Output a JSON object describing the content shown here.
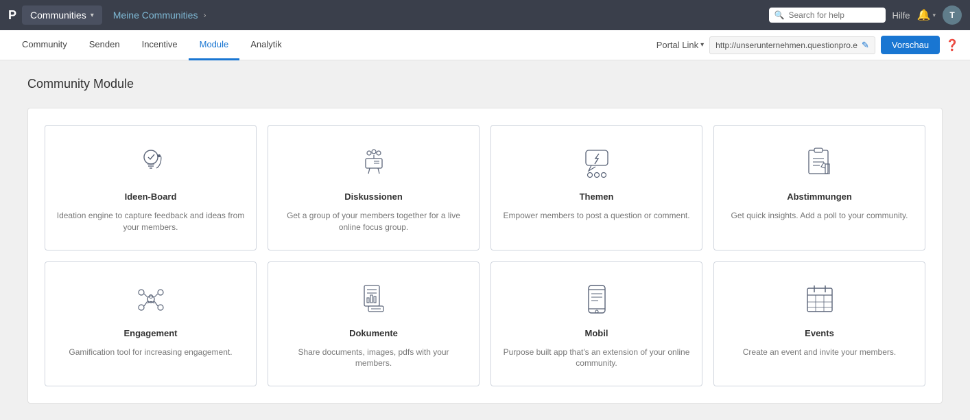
{
  "topbar": {
    "logo": "P",
    "brand_label": "Communities",
    "breadcrumb_link": "Meine Communities",
    "breadcrumb_sep": "›",
    "search_placeholder": "Search for help",
    "help_label": "Hilfe",
    "user_initial": "T"
  },
  "secnav": {
    "items": [
      {
        "label": "Community",
        "active": false
      },
      {
        "label": "Senden",
        "active": false
      },
      {
        "label": "Incentive",
        "active": false
      },
      {
        "label": "Module",
        "active": true
      },
      {
        "label": "Analytik",
        "active": false
      }
    ],
    "portal_link_label": "Portal Link",
    "portal_url": "http://unserunternehmen.questionpro.e",
    "vorschau_label": "Vorschau"
  },
  "main": {
    "page_title": "Community Module",
    "modules": [
      {
        "id": "ideen-board",
        "title": "Ideen-Board",
        "desc": "Ideation engine to capture feedback and ideas from your members.",
        "icon": "lightbulb"
      },
      {
        "id": "diskussionen",
        "title": "Diskussionen",
        "desc": "Get a group of your members together for a live online focus group.",
        "icon": "discussion"
      },
      {
        "id": "themen",
        "title": "Themen",
        "desc": "Empower members to post a question or comment.",
        "icon": "topics"
      },
      {
        "id": "abstimmungen",
        "title": "Abstimmungen",
        "desc": "Get quick insights. Add a poll to your community.",
        "icon": "poll"
      },
      {
        "id": "engagement",
        "title": "Engagement",
        "desc": "Gamification tool for increasing engagement.",
        "icon": "engagement"
      },
      {
        "id": "dokumente",
        "title": "Dokumente",
        "desc": "Share documents, images, pdfs with your members.",
        "icon": "documents"
      },
      {
        "id": "mobil",
        "title": "Mobil",
        "desc": "Purpose built app that's an extension of your online community.",
        "icon": "mobile"
      },
      {
        "id": "events",
        "title": "Events",
        "desc": "Create an event and invite your members.",
        "icon": "events"
      }
    ]
  }
}
